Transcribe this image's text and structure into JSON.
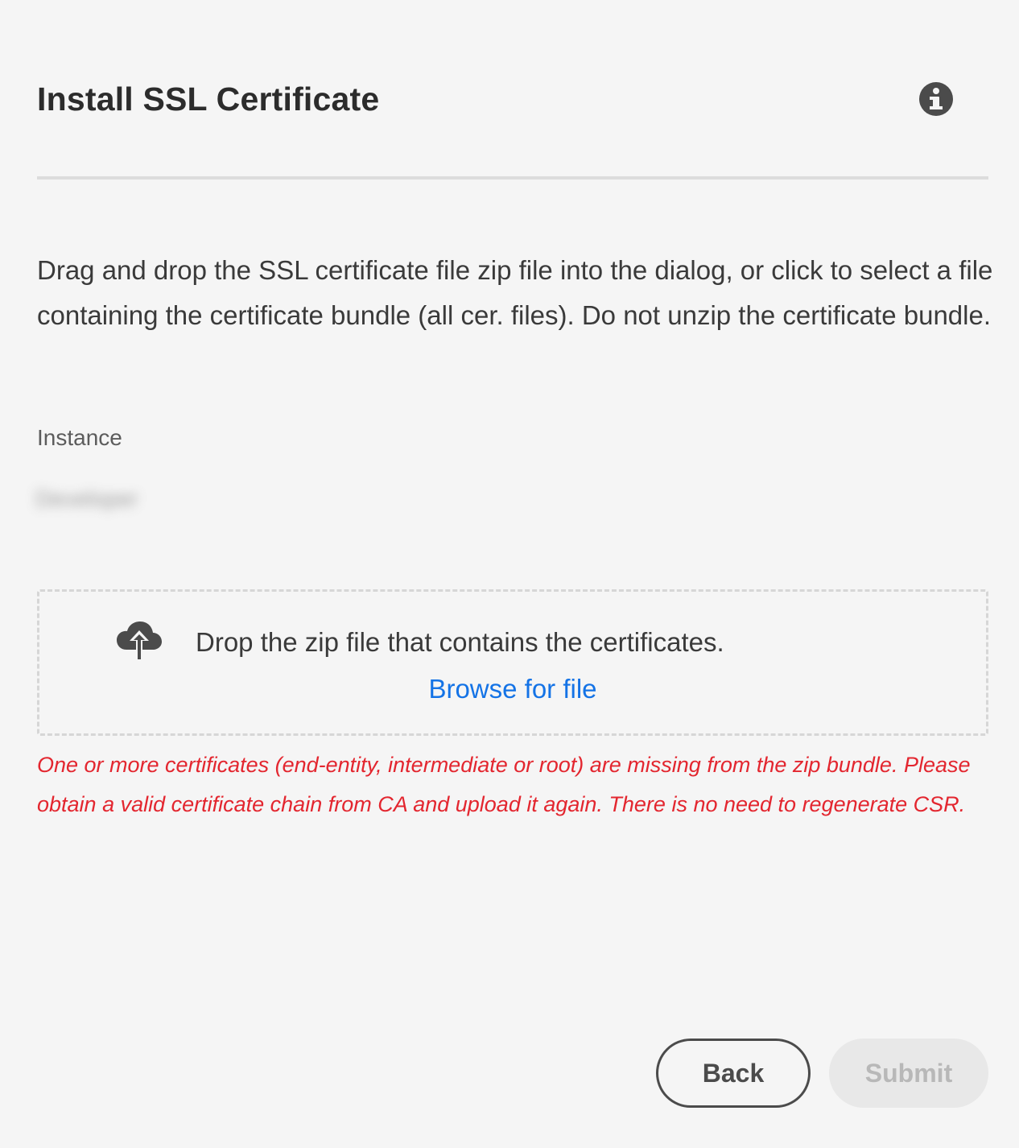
{
  "dialog": {
    "title": "Install SSL Certificate",
    "info_icon": "info-icon",
    "description": "Drag and drop the SSL certificate file zip file into the dialog, or click to select a file containing the certificate bundle (all cer. files). Do not unzip the certificate bundle.",
    "instance": {
      "label": "Instance",
      "value": "Developer"
    },
    "dropzone": {
      "icon": "cloud-upload-icon",
      "text": "Drop the zip file that contains the certificates.",
      "browse_label": "Browse for file"
    },
    "error_message": "One or more certificates (end-entity, intermediate or root) are missing from the zip bundle. Please obtain a valid certificate chain from CA and upload it again. There is no need to regenerate CSR.",
    "buttons": {
      "back_label": "Back",
      "submit_label": "Submit"
    }
  },
  "colors": {
    "background": "#f5f5f5",
    "link": "#1473e6",
    "error": "#e3262f",
    "button_border": "#4b4b4b",
    "button_disabled_bg": "#e8e8e8"
  }
}
